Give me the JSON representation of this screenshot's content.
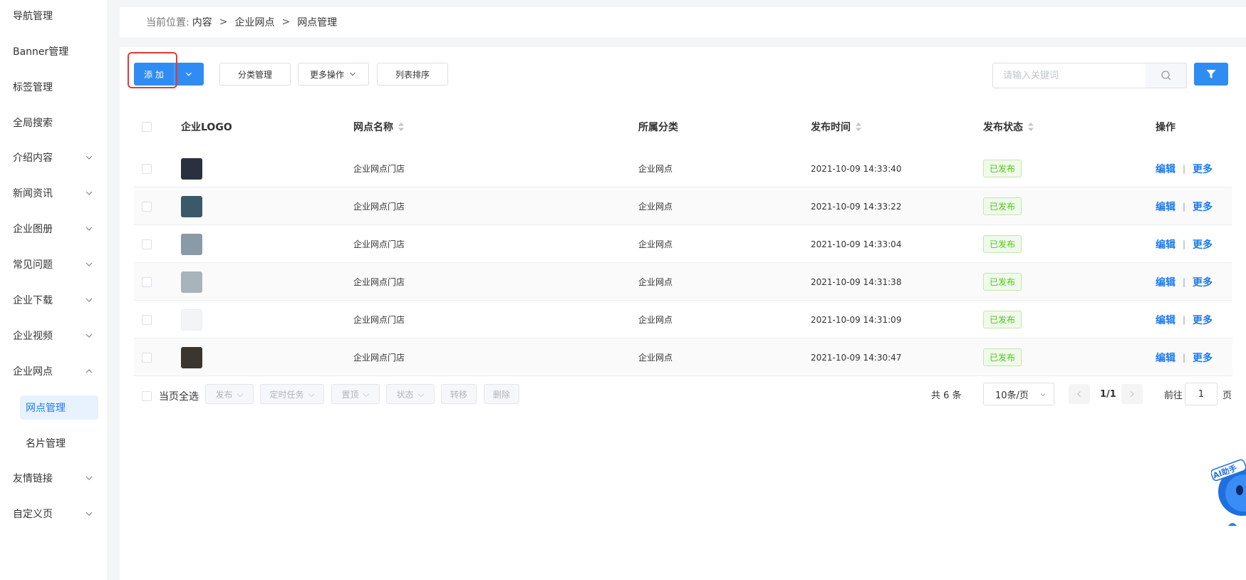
{
  "sidebar": {
    "items": [
      {
        "label": "导航管理"
      },
      {
        "label": "Banner管理"
      },
      {
        "label": "标签管理"
      },
      {
        "label": "全局搜索"
      },
      {
        "label": "介绍内容"
      },
      {
        "label": "新闻资讯"
      },
      {
        "label": "企业图册"
      },
      {
        "label": "常见问题"
      },
      {
        "label": "企业下载"
      },
      {
        "label": "企业视频"
      },
      {
        "label": "企业网点"
      },
      {
        "label": "友情链接"
      },
      {
        "label": "自定义页"
      }
    ],
    "sub_items": [
      {
        "label": "网点管理",
        "active": true
      },
      {
        "label": "名片管理",
        "active": false
      }
    ]
  },
  "breadcrumb": {
    "prefix": "当前位置:",
    "items": [
      "内容",
      "企业网点",
      "网点管理"
    ],
    "separator": ">"
  },
  "toolbar": {
    "add_label": "添 加",
    "category_label": "分类管理",
    "more_label": "更多操作",
    "sort_label": "列表排序",
    "search_placeholder": "请输入关键词"
  },
  "table": {
    "columns": {
      "logo": "企业LOGO",
      "name": "网点名称",
      "category": "所属分类",
      "time": "发布时间",
      "status": "发布状态",
      "ops": "操作"
    },
    "edit_label": "编辑",
    "more_label": "更多",
    "rows": [
      {
        "name": "企业网点门店",
        "category": "企业网点",
        "time": "2021-10-09 14:33:40",
        "status": "已发布",
        "thumb_color": "#2a3040"
      },
      {
        "name": "企业网点门店",
        "category": "企业网点",
        "time": "2021-10-09 14:33:22",
        "status": "已发布",
        "thumb_color": "#3a5a6a"
      },
      {
        "name": "企业网点门店",
        "category": "企业网点",
        "time": "2021-10-09 14:33:04",
        "status": "已发布",
        "thumb_color": "#8a9aa6"
      },
      {
        "name": "企业网点门店",
        "category": "企业网点",
        "time": "2021-10-09 14:31:38",
        "status": "已发布",
        "thumb_color": "#a8b4bc"
      },
      {
        "name": "企业网点门店",
        "category": "企业网点",
        "time": "2021-10-09 14:31:09",
        "status": "已发布",
        "thumb_color": "#f3f4f6"
      },
      {
        "name": "企业网点门店",
        "category": "企业网点",
        "time": "2021-10-09 14:30:47",
        "status": "已发布",
        "thumb_color": "#3b3530"
      }
    ]
  },
  "footer": {
    "select_all_label": "当页全选",
    "actions": [
      "发布",
      "定时任务",
      "置顶",
      "状态",
      "转移",
      "删除"
    ],
    "total_label": "共 6 条",
    "page_size": "10条/页",
    "page_indicator": "1/1",
    "goto_prefix": "前往",
    "goto_value": "1",
    "goto_suffix": "页"
  },
  "ai_helper_label": "AI助手",
  "colors": {
    "primary": "#2f8cf3",
    "link": "#1a7bf0",
    "success": "#52c41a",
    "highlight": "#e53935"
  }
}
